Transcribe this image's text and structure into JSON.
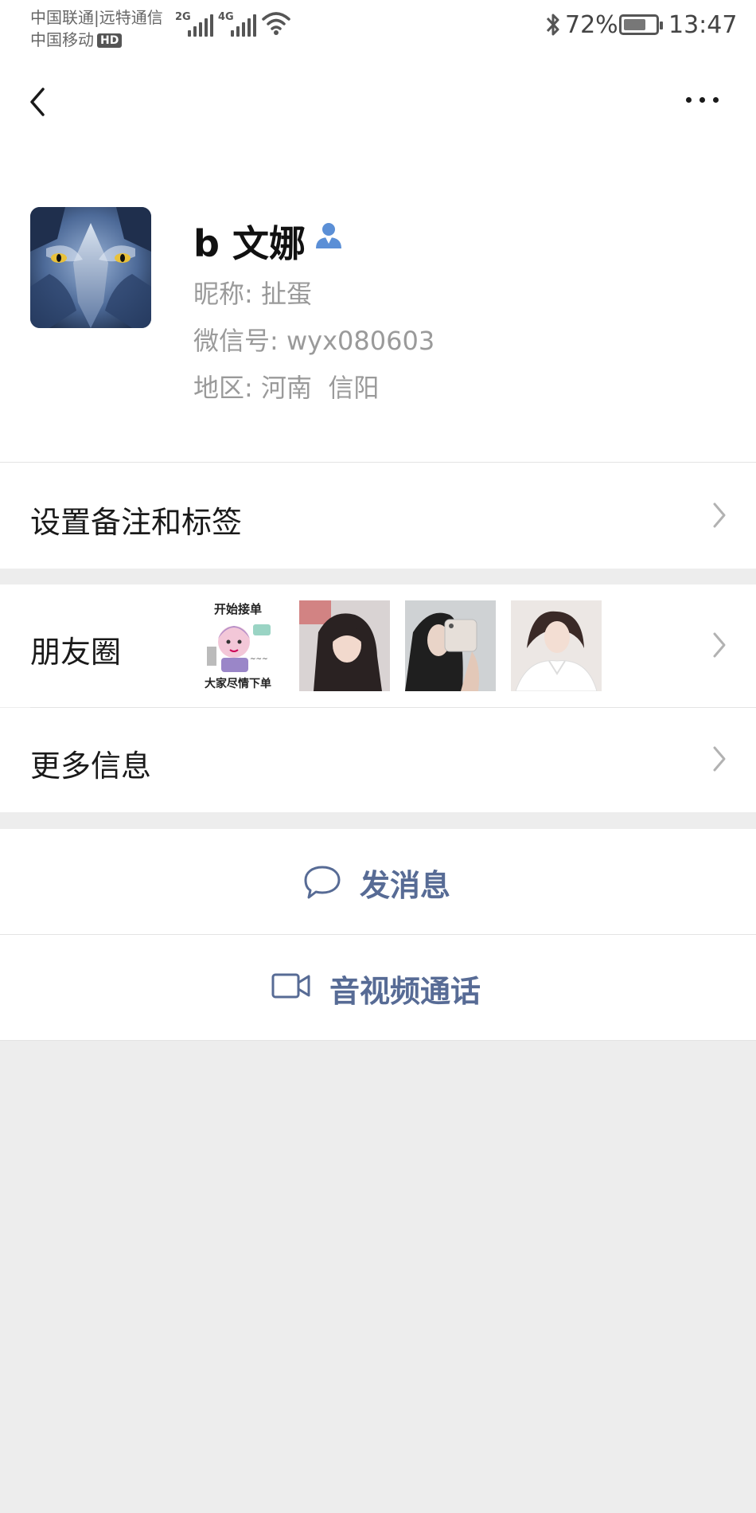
{
  "status_bar": {
    "carrier_line1": "中国联通|远特通信",
    "carrier_line2": "中国移动",
    "hd_label": "HD",
    "net1_label": "2G",
    "net2_label": "4G",
    "battery_percent": "72%",
    "battery_level": 0.72,
    "time": "13:47",
    "icons": [
      "signal-icon",
      "wifi-icon",
      "bluetooth-icon",
      "battery-icon"
    ]
  },
  "nav": {
    "back_icon": "chevron-left-icon",
    "more_icon": "more-dots-icon"
  },
  "profile": {
    "display_name": "b 文娜",
    "badge_icon": "contact-person-icon",
    "nickname_label": "昵称:",
    "nickname": "扯蛋",
    "wechat_id_label": "微信号:",
    "wechat_id": "wyx080603",
    "region_label": "地区:",
    "region": "河南  信阳"
  },
  "cells": {
    "remark_label": "设置备注和标签",
    "moments_label": "朋友圈",
    "more_info_label": "更多信息"
  },
  "moments_thumbnails": [
    {
      "name": "moments-thumbnail-1",
      "top_text": "开始接单",
      "bottom_text": "大家尽情下单"
    },
    {
      "name": "moments-thumbnail-2"
    },
    {
      "name": "moments-thumbnail-3"
    },
    {
      "name": "moments-thumbnail-4"
    }
  ],
  "actions": {
    "message_label": "发消息",
    "message_icon": "chat-bubble-icon",
    "call_label": "音视频通话",
    "call_icon": "video-camera-icon"
  },
  "colors": {
    "page_background": "#ededed",
    "card_background": "#ffffff",
    "link_blue": "#576b95",
    "secondary_text": "#9a9a9a",
    "badge_blue": "#5b8fd6"
  }
}
